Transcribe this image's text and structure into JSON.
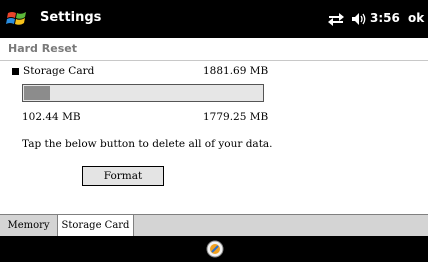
{
  "titlebar": {
    "title": "Settings",
    "clock": "3:56",
    "ok_label": "ok",
    "icons": [
      "windows-start-icon",
      "connectivity-icon",
      "volume-icon"
    ]
  },
  "section": {
    "title": "Hard Reset"
  },
  "storage": {
    "name": "Storage Card",
    "total": "1881.69 MB",
    "used": "102.44 MB",
    "free": "1779.25 MB",
    "used_fraction": 0.054
  },
  "instruction": "Tap the below button to delete all of your data.",
  "format_button": {
    "label": "Format"
  },
  "tabs": [
    {
      "label": "Memory",
      "selected": false
    },
    {
      "label": "Storage Card",
      "selected": true
    }
  ],
  "bottombar": {
    "icons": [
      "input-panel-icon"
    ]
  },
  "colors": {
    "bar_background": "#000000",
    "progress_fill": "#8c8c8c",
    "header_text": "#7a7a7a"
  }
}
